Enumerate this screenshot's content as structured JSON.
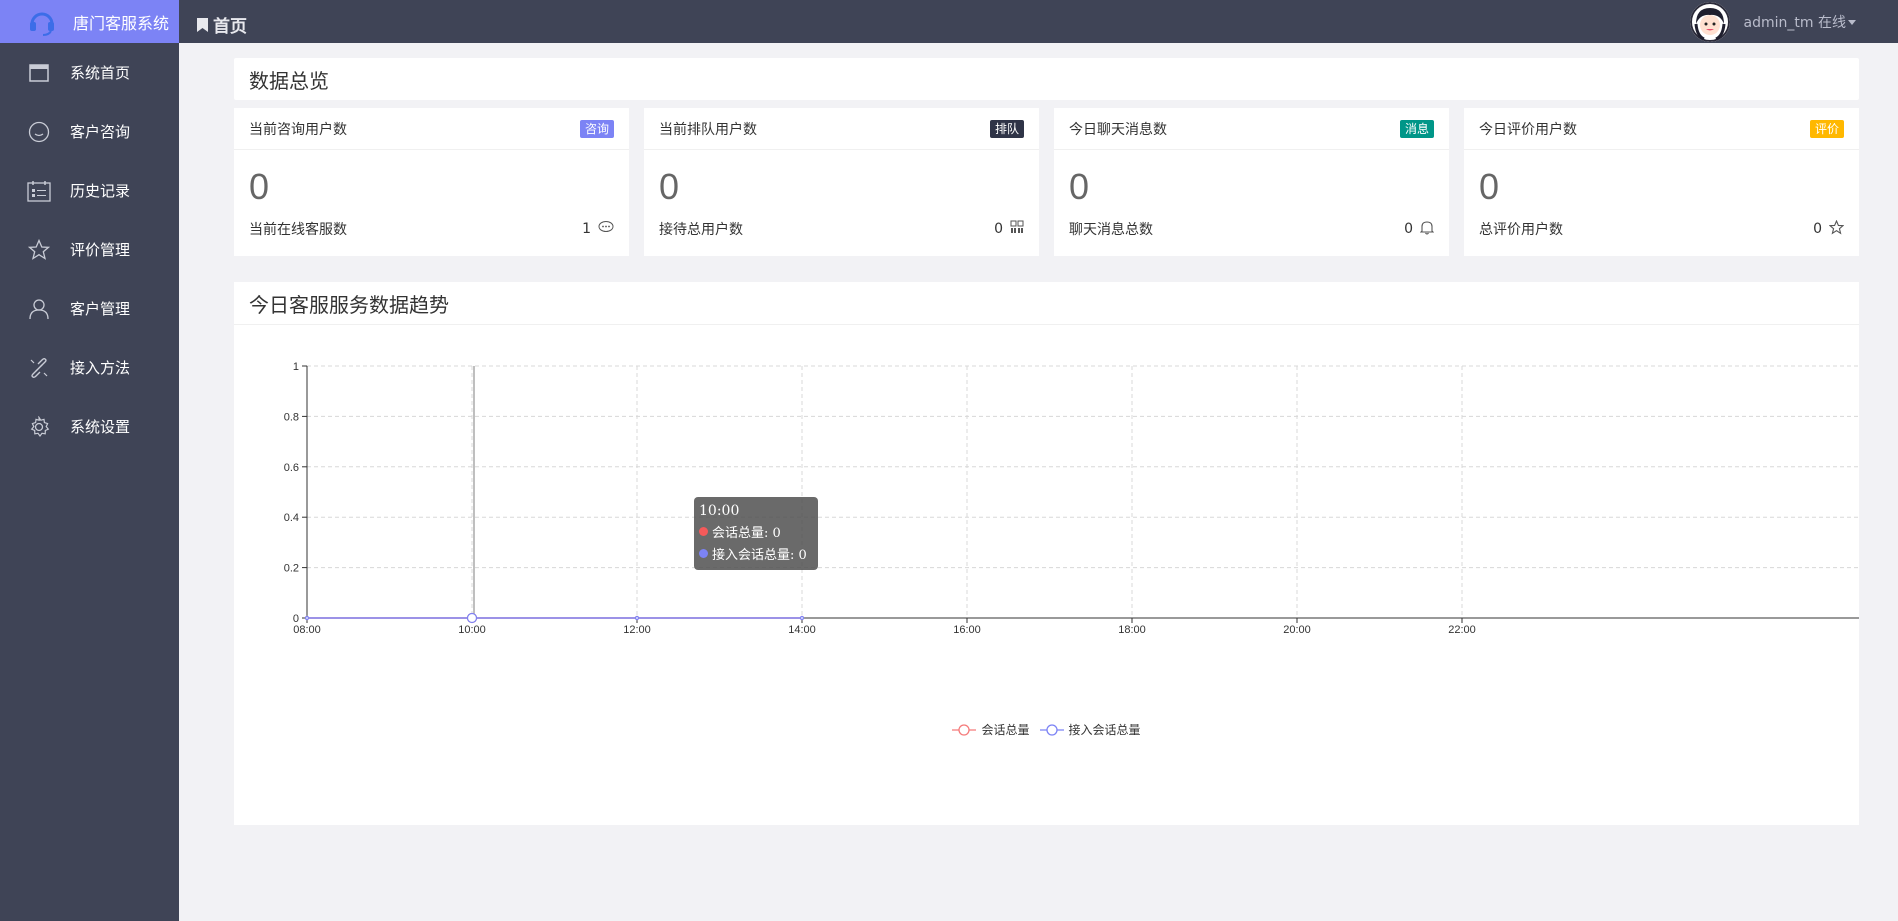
{
  "app": {
    "title": "唐门客服系统"
  },
  "header": {
    "breadcrumb": "首页",
    "user_label": "admin_tm 在线"
  },
  "sidebar": {
    "items": [
      {
        "label": "系统首页",
        "icon": "window-icon"
      },
      {
        "label": "客户咨询",
        "icon": "smile-icon"
      },
      {
        "label": "历史记录",
        "icon": "calendar-icon"
      },
      {
        "label": "评价管理",
        "icon": "star-icon"
      },
      {
        "label": "客户管理",
        "icon": "user-icon"
      },
      {
        "label": "接入方法",
        "icon": "link-icon"
      },
      {
        "label": "系统设置",
        "icon": "gear-icon"
      }
    ]
  },
  "overview": {
    "title": "数据总览"
  },
  "cards": [
    {
      "title": "当前咨询用户数",
      "badge": "咨询",
      "badge_color": "#7c83f5",
      "value": "0",
      "foot_label": "当前在线客服数",
      "foot_value": "1",
      "foot_icon": "chat-icon"
    },
    {
      "title": "当前排队用户数",
      "badge": "排队",
      "badge_color": "#2f3447",
      "value": "0",
      "foot_label": "接待总用户数",
      "foot_value": "0",
      "foot_icon": "grid-icon"
    },
    {
      "title": "今日聊天消息数",
      "badge": "消息",
      "badge_color": "#009688",
      "value": "0",
      "foot_label": "聊天消息总数",
      "foot_value": "0",
      "foot_icon": "bell-icon"
    },
    {
      "title": "今日评价用户数",
      "badge": "评价",
      "badge_color": "#ffb800",
      "value": "0",
      "foot_label": "总评价用户数",
      "foot_value": "0",
      "foot_icon": "star-icon"
    }
  ],
  "trend": {
    "title": "今日客服服务数据趋势",
    "tooltip": {
      "time": "10:00",
      "rows": [
        "会话总量: 0",
        "接入会话总量: 0"
      ]
    }
  },
  "chart_data": {
    "type": "line",
    "x": [
      "08:00",
      "10:00",
      "12:00",
      "14:00"
    ],
    "x_ticks": [
      "08:00",
      "10:00",
      "12:00",
      "14:00",
      "16:00",
      "18:00",
      "20:00",
      "22:00"
    ],
    "y_ticks": [
      "0",
      "0.2",
      "0.4",
      "0.6",
      "0.8",
      "1"
    ],
    "ylim": [
      0,
      1
    ],
    "grid": true,
    "legend_position": "bottom",
    "series": [
      {
        "name": "会话总量",
        "color": "#f57b7b",
        "values": [
          0,
          0,
          0,
          0
        ]
      },
      {
        "name": "接入会话总量",
        "color": "#7c83f5",
        "values": [
          0,
          0,
          0,
          0
        ]
      }
    ]
  }
}
